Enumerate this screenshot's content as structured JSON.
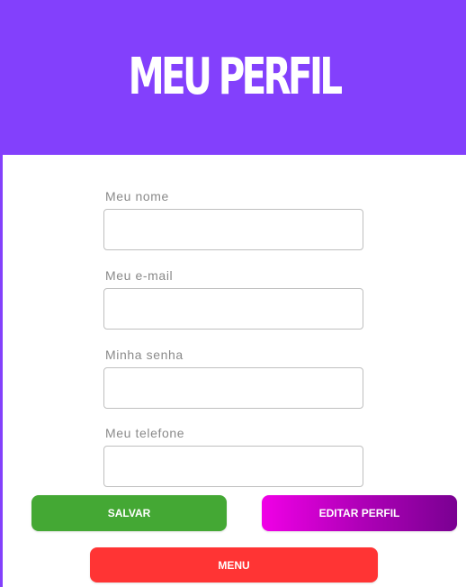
{
  "header": {
    "title": "MEU PERFIL"
  },
  "form": {
    "fields": [
      {
        "label": "Meu nome",
        "value": "",
        "placeholder": ""
      },
      {
        "label": "Meu e-mail",
        "value": "",
        "placeholder": ""
      },
      {
        "label": "Minha senha",
        "value": "",
        "placeholder": ""
      },
      {
        "label": "Meu telefone",
        "value": "",
        "placeholder": ""
      }
    ]
  },
  "buttons": {
    "save_label": "SALVAR",
    "edit_label": "EDITAR PERFIL",
    "menu_label": "MENU"
  },
  "colors": {
    "header_bg": "#8340fc",
    "save_bg": "#44a834",
    "edit_gradient_start": "#f000e6",
    "edit_gradient_end": "#7a0092",
    "menu_bg": "#ff3434"
  }
}
